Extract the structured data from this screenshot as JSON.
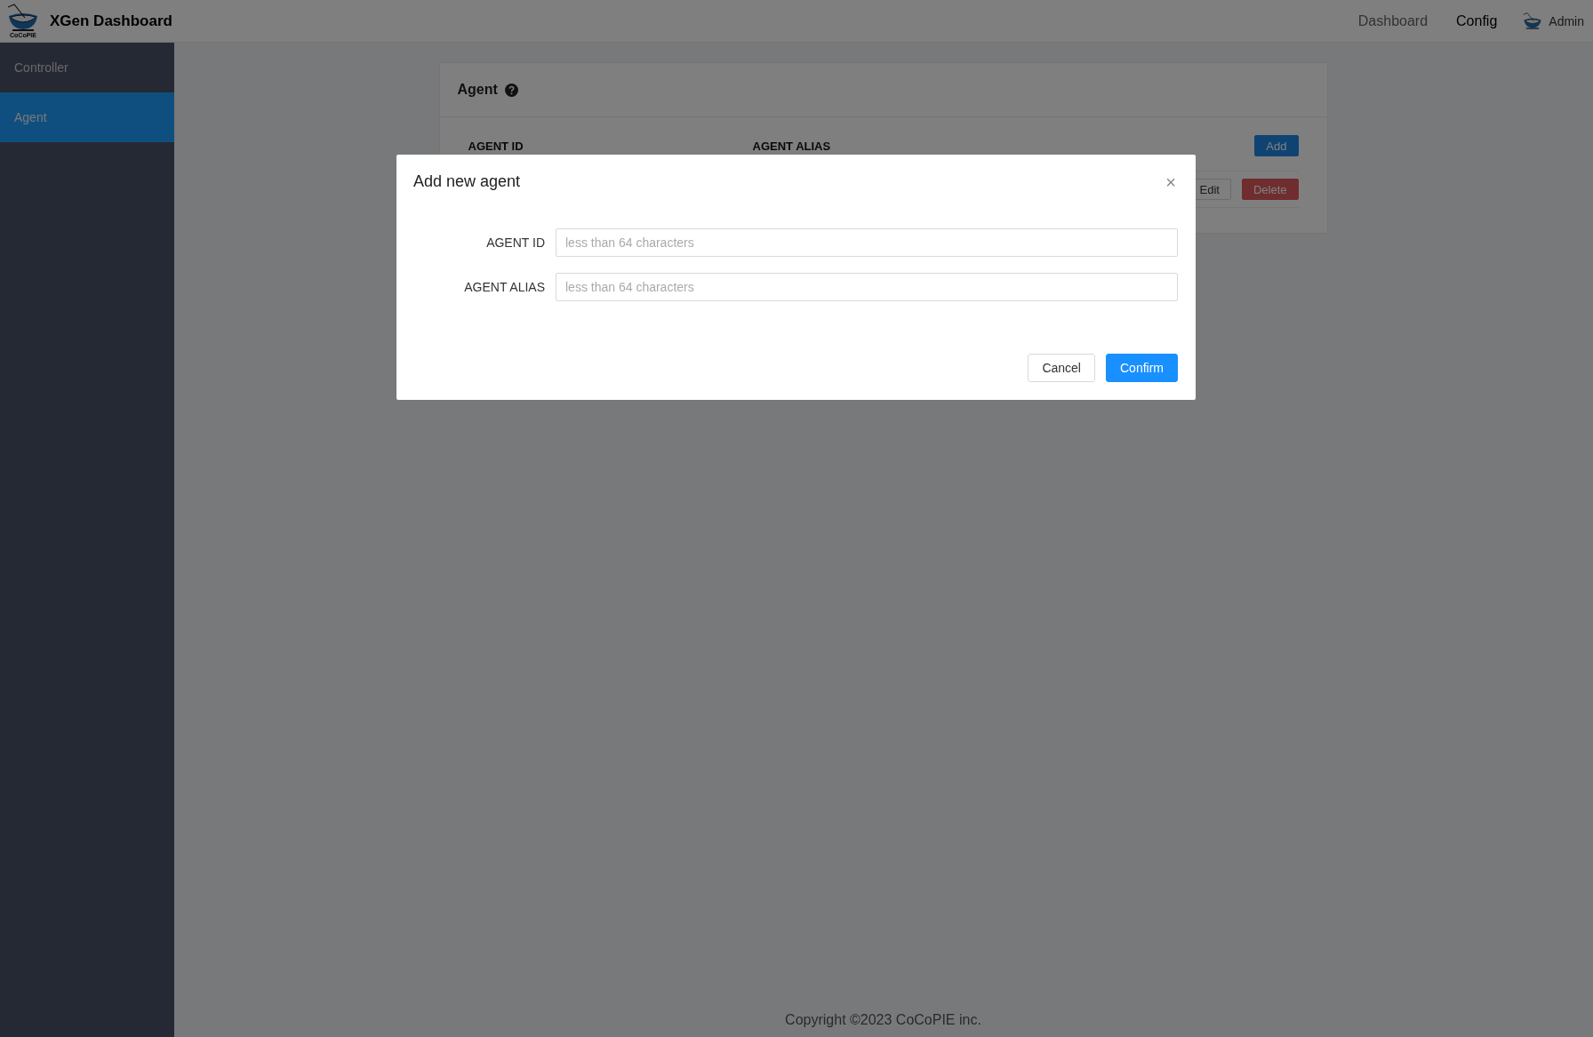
{
  "header": {
    "logo_text": "CoCoPIE",
    "title": "XGen Dashboard",
    "nav": [
      {
        "label": "Dashboard",
        "selected": false
      },
      {
        "label": "Config",
        "selected": true
      }
    ],
    "user": "Admin"
  },
  "sidebar": {
    "items": [
      {
        "label": "Controller",
        "selected": false
      },
      {
        "label": "Agent",
        "selected": true
      }
    ]
  },
  "card": {
    "title": "Agent",
    "columns": [
      "AGENT ID",
      "AGENT ALIAS"
    ],
    "add_button": "Add",
    "row_actions": [
      "Edit",
      "Delete"
    ]
  },
  "modal": {
    "title": "Add new agent",
    "close": "×",
    "fields": [
      {
        "label": "AGENT ID",
        "placeholder": "less than 64 characters"
      },
      {
        "label": "AGENT ALIAS",
        "placeholder": "less than 64 characters"
      }
    ],
    "cancel": "Cancel",
    "confirm": "Confirm"
  },
  "footer": "Copyright ©2023 CoCoPIE inc."
}
